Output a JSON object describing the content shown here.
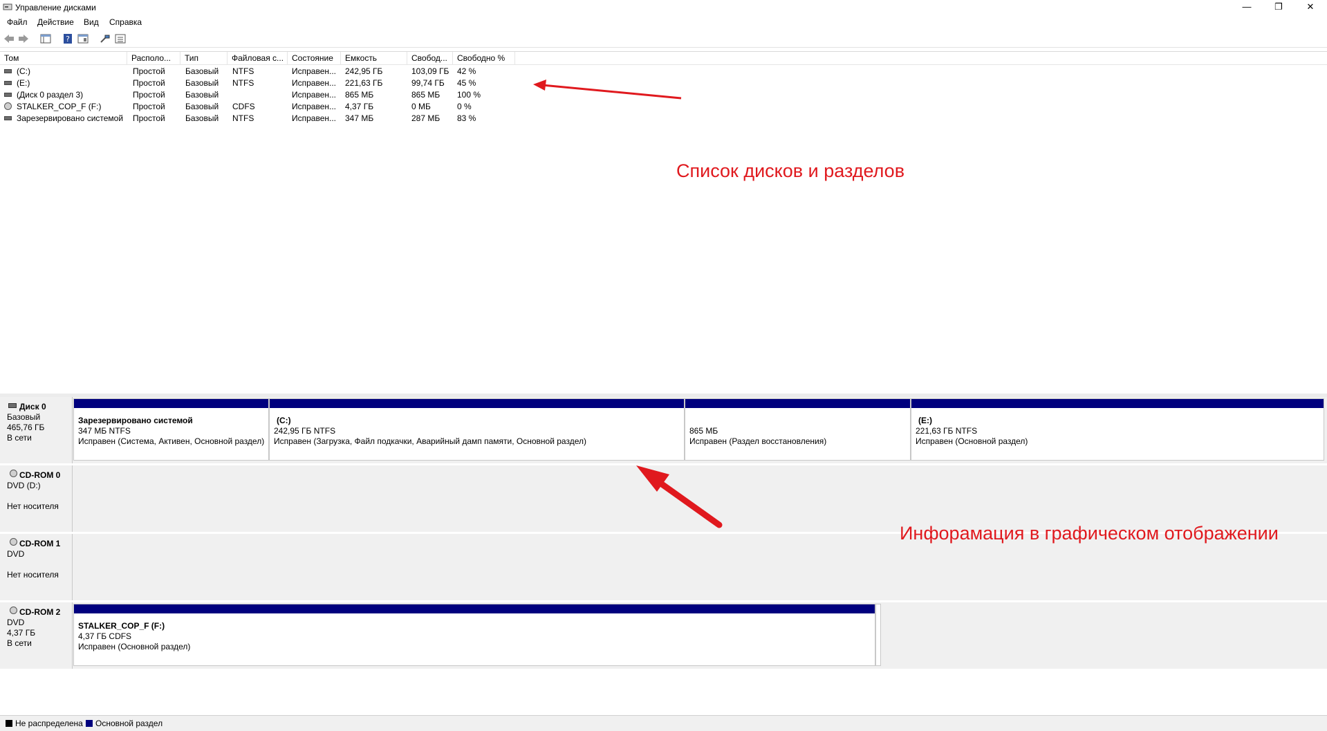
{
  "window": {
    "title": "Управление дисками",
    "minimize": "—",
    "restore": "❐",
    "close": "✕"
  },
  "menu": [
    "Файл",
    "Действие",
    "Вид",
    "Справка"
  ],
  "list": {
    "headers": [
      "Том",
      "Располо...",
      "Тип",
      "Файловая с...",
      "Состояние",
      "Емкость",
      "Свобод...",
      "Свободно %"
    ],
    "rows": [
      {
        "icon": "volume",
        "cells": [
          "(C:)",
          "Простой",
          "Базовый",
          "NTFS",
          "Исправен...",
          "242,95 ГБ",
          "103,09 ГБ",
          "42 %"
        ]
      },
      {
        "icon": "volume",
        "cells": [
          "(E:)",
          "Простой",
          "Базовый",
          "NTFS",
          "Исправен...",
          "221,63 ГБ",
          "99,74 ГБ",
          "45 %"
        ]
      },
      {
        "icon": "volume",
        "cells": [
          "(Диск 0 раздел 3)",
          "Простой",
          "Базовый",
          "",
          "Исправен...",
          "865 МБ",
          "865 МБ",
          "100 %"
        ]
      },
      {
        "icon": "cdrom",
        "cells": [
          "STALKER_COP_F (F:)",
          "Простой",
          "Базовый",
          "CDFS",
          "Исправен...",
          "4,37 ГБ",
          "0 МБ",
          "0 %"
        ]
      },
      {
        "icon": "volume",
        "cells": [
          "Зарезервировано системой",
          "Простой",
          "Базовый",
          "NTFS",
          "Исправен...",
          "347 МБ",
          "287 МБ",
          "83 %"
        ]
      }
    ]
  },
  "annotations": {
    "list": "Список дисков и разделов",
    "graphic": "Инфорамация в графическом отображении"
  },
  "disks": [
    {
      "name": "Диск 0",
      "line1": "Базовый",
      "line2": "465,76 ГБ",
      "line3": "В сети",
      "partitions": [
        {
          "title": "Зарезервировано системой",
          "size": "347 МБ NTFS",
          "status": "Исправен (Система, Активен, Основной раздел)"
        },
        {
          "title": "(C:)",
          "size": "242,95 ГБ NTFS",
          "status": "Исправен (Загрузка, Файл подкачки, Аварийный дамп памяти, Основной раздел)"
        },
        {
          "title": "",
          "size": "865 МБ",
          "status": "Исправен (Раздел восстановления)"
        },
        {
          "title": "(E:)",
          "size": "221,63 ГБ NTFS",
          "status": "Исправен (Основной раздел)"
        }
      ]
    },
    {
      "name": "CD-ROM 0",
      "line1": "DVD (D:)",
      "line2": "",
      "line3": "Нет носителя"
    },
    {
      "name": "CD-ROM 1",
      "line1": "DVD",
      "line2": "",
      "line3": "Нет носителя"
    },
    {
      "name": "CD-ROM 2",
      "line1": "DVD",
      "line2": "4,37 ГБ",
      "line3": "В сети",
      "partitions": [
        {
          "title": "STALKER_COP_F  (F:)",
          "size": "4,37 ГБ CDFS",
          "status": "Исправен (Основной раздел)"
        }
      ]
    }
  ],
  "legend": [
    {
      "label": "Не распределена",
      "color": "#000000"
    },
    {
      "label": "Основной раздел",
      "color": "#00007e"
    }
  ],
  "colors": {
    "partition_bar": "#00007e",
    "annotation": "#e0191e"
  }
}
